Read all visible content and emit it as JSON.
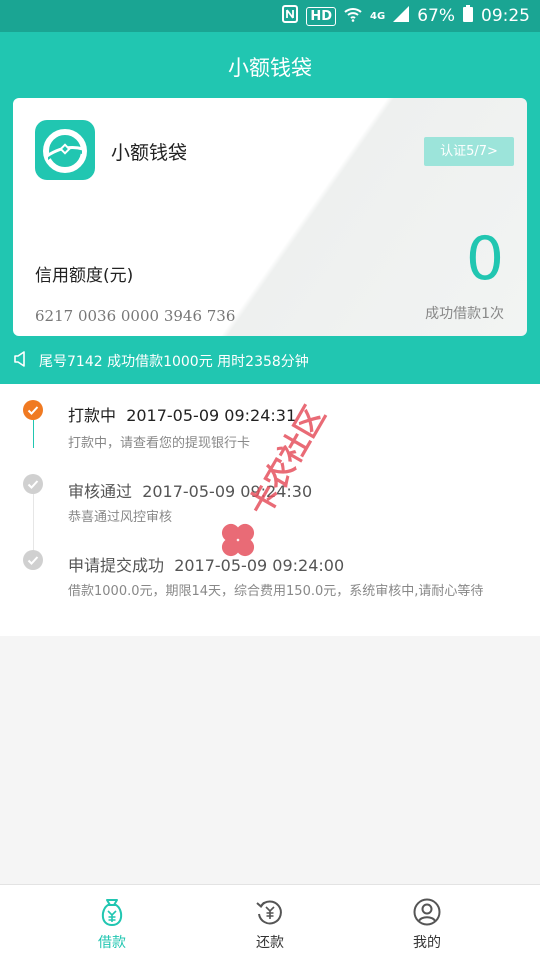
{
  "status_bar": {
    "hd": "HD",
    "network": "4G",
    "battery": "67%",
    "time": "09:25"
  },
  "header": {
    "title": "小额钱袋"
  },
  "card": {
    "name": "小额钱袋",
    "verify_button": "认证5/7>",
    "credit_label": "信用额度(元)",
    "credit_amount": "0",
    "card_number": "6217 0036 0000 3946 736",
    "success_count": "成功借款1次"
  },
  "notice": {
    "text": "尾号7142 成功借款1000元 用时2358分钟"
  },
  "timeline": [
    {
      "status": "打款中",
      "time": "2017-05-09 09:24:31",
      "desc": "打款中，请查看您的提现银行卡",
      "active": true
    },
    {
      "status": "审核通过",
      "time": "2017-05-09 09:24:30",
      "desc": "恭喜通过风控审核",
      "active": false
    },
    {
      "status": "申请提交成功",
      "time": "2017-05-09 09:24:00",
      "desc": "借款1000.0元，期限14天，综合费用150.0元，系统审核中,请耐心等待",
      "active": false
    }
  ],
  "watermark": {
    "text": "卡农社区"
  },
  "tabs": [
    {
      "label": "借款",
      "icon": "money-bag-icon",
      "active": true
    },
    {
      "label": "还款",
      "icon": "repay-icon",
      "active": false
    },
    {
      "label": "我的",
      "icon": "user-icon",
      "active": false
    }
  ],
  "colors": {
    "primary": "#21c6b1",
    "status_bar": "#1aa593",
    "active_dot": "#f07a22",
    "inactive_dot": "#cfcfcf"
  }
}
